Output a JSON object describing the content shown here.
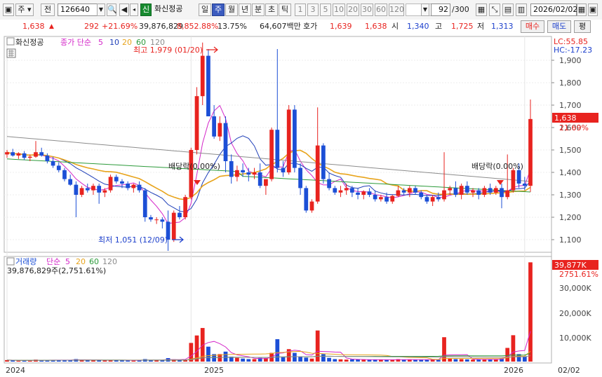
{
  "toolbar": {
    "market": "주",
    "prev": "전",
    "code": "126640",
    "name_badge": "신",
    "stock_name": "화신정공",
    "period_tabs": [
      "일",
      "주",
      "월",
      "년",
      "분",
      "초",
      "틱"
    ],
    "numbers": [
      "1",
      "3",
      "5",
      "10",
      "20",
      "30",
      "60",
      "120"
    ],
    "count": "92",
    "count_total": "/300",
    "date": "2026/02/02"
  },
  "ticker": {
    "price": "1,638",
    "price_arrow": "▲",
    "change": "292",
    "change_pct": "+21.69%",
    "volume": "39,876,829",
    "volume_pct": "8,852.88%",
    "turnover": "13.75%",
    "amount": "64,607백만",
    "hoga_label": "호가",
    "hoga_ask": "1,639",
    "hoga_bid": "1,638",
    "open_label": "시",
    "open": "1,340",
    "high_label": "고",
    "high": "1,725",
    "low_label": "저",
    "low": "1,313",
    "buy": "매수",
    "sell": "매도",
    "eval": "평"
  },
  "price_panel": {
    "title": "화신정공",
    "ma_label": "종가 단순",
    "ma_periods": [
      "5",
      "10",
      "20",
      "60",
      "120"
    ],
    "lc": "LC:55.85",
    "hc": "HC:-17.23",
    "max_label": "최고 1,979 (01/20)",
    "min_label": "최저 1,051 (12/09)",
    "div_label1": "배당락(0.00%)",
    "div_label2": "배당락(0.00%)",
    "price_tag": "1,638",
    "pct_tag": "21.69%",
    "y_ticks": [
      "1,900",
      "1,800",
      "1,700",
      "1,600",
      "1,500",
      "1,400",
      "1,300",
      "1,200",
      "1,100"
    ]
  },
  "volume_panel": {
    "title": "거래량",
    "ma_label": "단순",
    "ma_periods": [
      "5",
      "20",
      "60",
      "120"
    ],
    "current": "39,876,829주(2,751.61%)",
    "tag": "39,877K",
    "tag_pct": "2751.61%",
    "y_ticks": [
      "30,000K",
      "20,000K",
      "10,000K"
    ]
  },
  "x_axis": {
    "labels": [
      "2024",
      "2025",
      "2026"
    ],
    "right_label": "02/02"
  },
  "colors": {
    "up": "#e8231f",
    "down": "#1c4fd6",
    "ma5": "#d427c9",
    "ma10": "#1f3fb8",
    "ma20": "#e8a41c",
    "ma60": "#2c9a3a",
    "ma120": "#8c8c8c"
  },
  "chart_data": {
    "type": "candlestick",
    "y_range": [
      1050,
      2000
    ],
    "candles": [
      [
        1480,
        1500,
        1465,
        1490
      ],
      [
        1490,
        1505,
        1470,
        1475
      ],
      [
        1475,
        1490,
        1460,
        1485
      ],
      [
        1485,
        1495,
        1455,
        1465
      ],
      [
        1465,
        1480,
        1450,
        1470
      ],
      [
        1470,
        1540,
        1465,
        1490
      ],
      [
        1490,
        1510,
        1470,
        1475
      ],
      [
        1475,
        1485,
        1440,
        1450
      ],
      [
        1450,
        1470,
        1420,
        1430
      ],
      [
        1430,
        1445,
        1400,
        1410
      ],
      [
        1410,
        1420,
        1360,
        1370
      ],
      [
        1370,
        1390,
        1340,
        1345
      ],
      [
        1345,
        1360,
        1200,
        1300
      ],
      [
        1300,
        1340,
        1290,
        1330
      ],
      [
        1330,
        1350,
        1310,
        1320
      ],
      [
        1320,
        1350,
        1300,
        1340
      ],
      [
        1340,
        1350,
        1260,
        1310
      ],
      [
        1310,
        1330,
        1290,
        1320
      ],
      [
        1320,
        1390,
        1310,
        1380
      ],
      [
        1380,
        1390,
        1350,
        1360
      ],
      [
        1360,
        1370,
        1330,
        1350
      ],
      [
        1350,
        1360,
        1320,
        1330
      ],
      [
        1330,
        1350,
        1310,
        1345
      ],
      [
        1345,
        1360,
        1310,
        1320
      ],
      [
        1320,
        1330,
        1180,
        1200
      ],
      [
        1200,
        1210,
        1180,
        1190
      ],
      [
        1190,
        1200,
        1170,
        1190
      ],
      [
        1190,
        1200,
        1150,
        1180
      ],
      [
        1180,
        1230,
        1050,
        1100
      ],
      [
        1100,
        1230,
        1090,
        1220
      ],
      [
        1220,
        1250,
        1190,
        1200
      ],
      [
        1200,
        1300,
        1190,
        1290
      ],
      [
        1290,
        1510,
        1280,
        1500
      ],
      [
        1500,
        1780,
        1480,
        1740
      ],
      [
        1740,
        1979,
        1700,
        1920
      ],
      [
        1920,
        1950,
        1650,
        1650
      ],
      [
        1650,
        1700,
        1550,
        1560
      ],
      [
        1560,
        1650,
        1540,
        1620
      ],
      [
        1620,
        1650,
        1400,
        1450
      ],
      [
        1450,
        1480,
        1350,
        1380
      ],
      [
        1380,
        1430,
        1360,
        1410
      ],
      [
        1410,
        1440,
        1380,
        1400
      ],
      [
        1400,
        1420,
        1360,
        1390
      ],
      [
        1390,
        1420,
        1370,
        1400
      ],
      [
        1400,
        1440,
        1330,
        1340
      ],
      [
        1340,
        1360,
        1300,
        1370
      ],
      [
        1370,
        1600,
        1360,
        1590
      ],
      [
        1590,
        1950,
        1400,
        1420
      ],
      [
        1420,
        1450,
        1380,
        1400
      ],
      [
        1400,
        1700,
        1390,
        1680
      ],
      [
        1680,
        1700,
        1400,
        1420
      ],
      [
        1420,
        1440,
        1300,
        1330
      ],
      [
        1330,
        1340,
        1220,
        1230
      ],
      [
        1230,
        1280,
        1220,
        1270
      ],
      [
        1270,
        1690,
        1260,
        1520
      ],
      [
        1520,
        1530,
        1350,
        1370
      ],
      [
        1370,
        1400,
        1320,
        1330
      ],
      [
        1330,
        1340,
        1300,
        1310
      ],
      [
        1310,
        1340,
        1290,
        1320
      ],
      [
        1320,
        1350,
        1300,
        1330
      ],
      [
        1330,
        1340,
        1290,
        1310
      ],
      [
        1310,
        1330,
        1280,
        1300
      ],
      [
        1300,
        1320,
        1280,
        1315
      ],
      [
        1315,
        1330,
        1290,
        1300
      ],
      [
        1300,
        1320,
        1270,
        1280
      ],
      [
        1280,
        1300,
        1270,
        1290
      ],
      [
        1290,
        1310,
        1260,
        1270
      ],
      [
        1270,
        1300,
        1260,
        1295
      ],
      [
        1295,
        1340,
        1290,
        1320
      ],
      [
        1320,
        1330,
        1300,
        1310
      ],
      [
        1310,
        1340,
        1290,
        1330
      ],
      [
        1330,
        1340,
        1300,
        1310
      ],
      [
        1310,
        1320,
        1280,
        1290
      ],
      [
        1290,
        1300,
        1260,
        1270
      ],
      [
        1270,
        1300,
        1250,
        1290
      ],
      [
        1290,
        1310,
        1270,
        1280
      ],
      [
        1280,
        1490,
        1270,
        1320
      ],
      [
        1320,
        1340,
        1300,
        1330
      ],
      [
        1330,
        1360,
        1290,
        1300
      ],
      [
        1300,
        1350,
        1280,
        1340
      ],
      [
        1340,
        1360,
        1300,
        1310
      ],
      [
        1310,
        1330,
        1290,
        1320
      ],
      [
        1320,
        1330,
        1280,
        1300
      ],
      [
        1300,
        1340,
        1290,
        1330
      ],
      [
        1330,
        1350,
        1300,
        1310
      ],
      [
        1310,
        1340,
        1300,
        1330
      ],
      [
        1330,
        1350,
        1240,
        1290
      ],
      [
        1290,
        1480,
        1280,
        1320
      ],
      [
        1320,
        1420,
        1310,
        1410
      ],
      [
        1410,
        1440,
        1330,
        1350
      ],
      [
        1350,
        1380,
        1320,
        1340
      ],
      [
        1340,
        1725,
        1313,
        1638
      ]
    ],
    "volumes": [
      0.6,
      0.5,
      0.4,
      0.5,
      0.5,
      0.8,
      0.5,
      0.5,
      0.6,
      0.6,
      0.7,
      0.6,
      1.0,
      0.6,
      0.5,
      0.5,
      0.6,
      0.5,
      0.7,
      0.5,
      0.5,
      0.5,
      0.4,
      0.5,
      1.0,
      0.5,
      0.5,
      0.6,
      1.4,
      0.9,
      0.6,
      0.8,
      7.5,
      10.5,
      13.5,
      6.0,
      3.0,
      3.0,
      4.0,
      2.0,
      1.5,
      1.2,
      1.0,
      1.0,
      1.5,
      1.4,
      3.5,
      9.0,
      2.0,
      5.0,
      3.5,
      2.0,
      1.6,
      1.2,
      12.5,
      3.0,
      1.5,
      1.0,
      0.9,
      0.8,
      0.9,
      0.9,
      0.7,
      0.7,
      0.8,
      0.7,
      0.8,
      0.7,
      1.0,
      0.8,
      0.8,
      0.7,
      0.7,
      0.8,
      0.9,
      0.7,
      9.8,
      1.2,
      1.0,
      1.0,
      0.9,
      0.8,
      0.8,
      0.9,
      0.9,
      0.9,
      1.3,
      5.5,
      10.6,
      3.0,
      2.0,
      39.9
    ],
    "x_labels": [
      "2024",
      "2025",
      "2026"
    ]
  }
}
